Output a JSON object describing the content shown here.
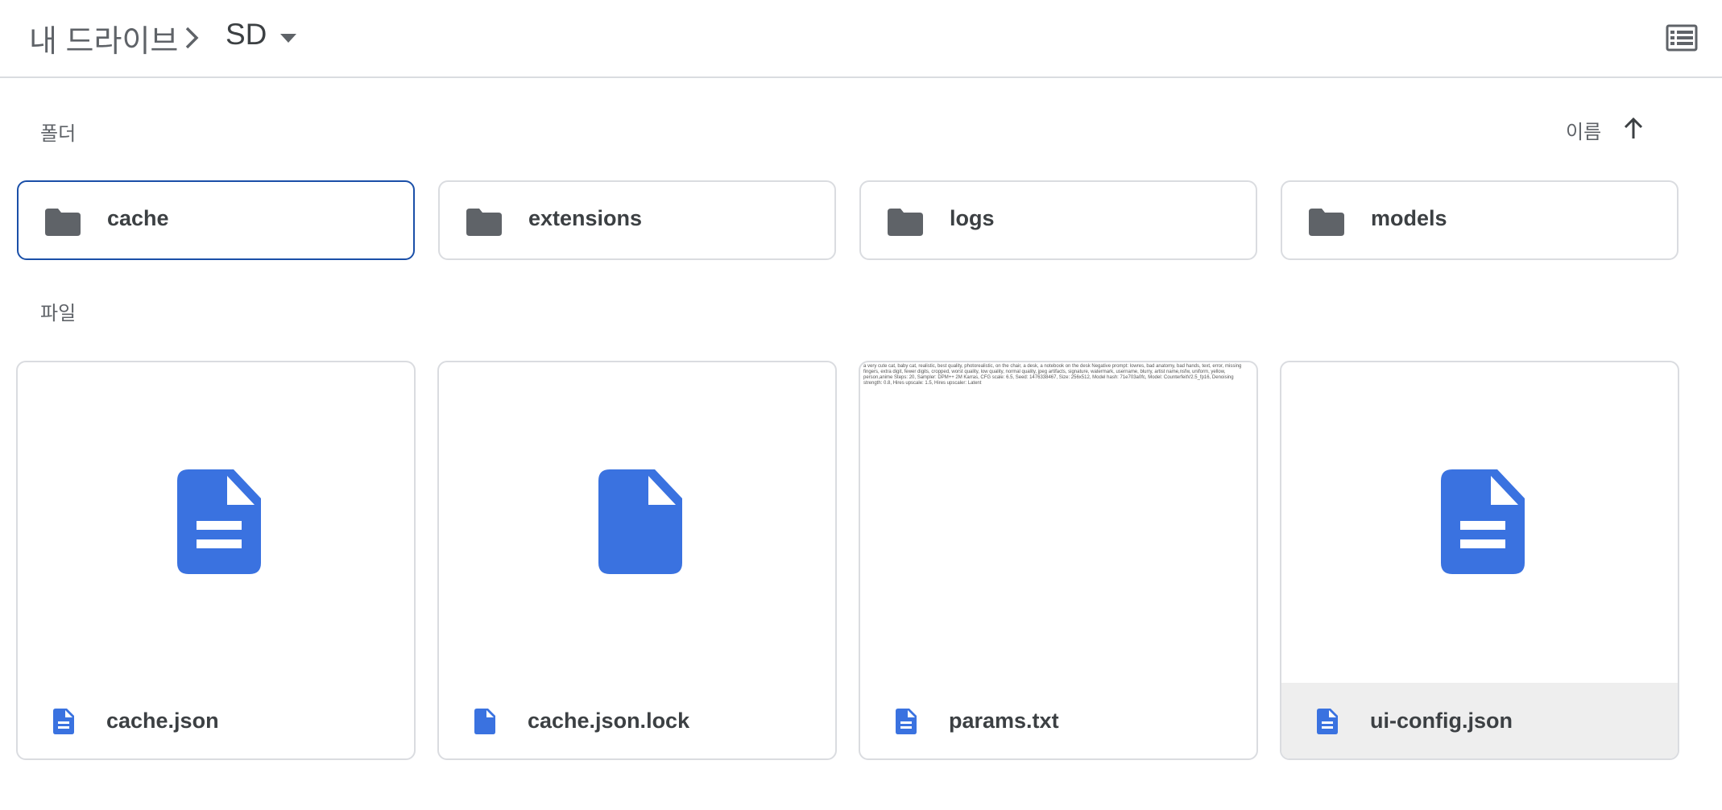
{
  "breadcrumb": {
    "root": "내 드라이브",
    "current": "SD"
  },
  "sections": {
    "folders_label": "폴더",
    "files_label": "파일",
    "sort_label": "이름"
  },
  "folders": [
    {
      "name": "cache"
    },
    {
      "name": "extensions"
    },
    {
      "name": "logs"
    },
    {
      "name": "models"
    }
  ],
  "files": [
    {
      "name": "cache.json",
      "icon": "google-doc-icon"
    },
    {
      "name": "cache.json.lock",
      "icon": "generic-file-icon"
    },
    {
      "name": "params.txt",
      "icon": "text-preview",
      "preview_text": "a very cute cat, baby cat, realistic, best quality, photorealistic, on the chair, a desk, a notebook on the desk Negative prompt: lowres, bad anatomy, bad hands, text, error, missing fingers, extra digit, fewer digits, cropped, worst quality, low quality, normal quality, jpeg artifacts, signature, watermark, username, blurry, artist name,nsfw, uniform, yellow, person,anime Steps: 20, Sampler: DPM++ 2M Karras, CFG scale: 6.5, Seed: 1476338467, Size: 256x512, Model hash: 71e703a0fc, Model: CounterfeitV2.5_fp16, Denoising strength: 0.8, Hires upscale: 1.5, Hires upscaler: Latent"
    },
    {
      "name": "ui-config.json",
      "icon": "google-doc-icon"
    }
  ],
  "colors": {
    "file_blue": "#3a72e0",
    "folder_gray": "#5f6368",
    "selected_border": "#1a4fa8"
  }
}
